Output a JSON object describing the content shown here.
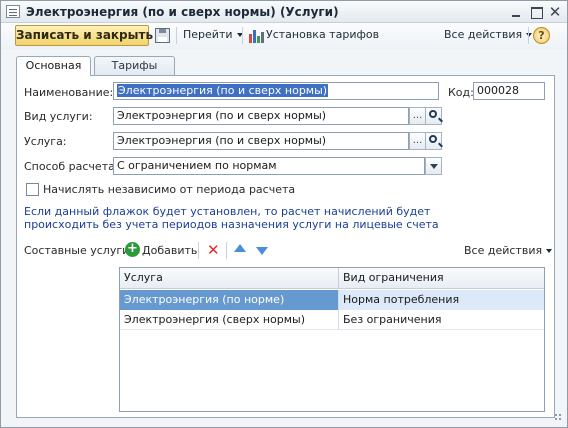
{
  "window": {
    "title": "Электроэнергия (по и сверх нормы) (Услуги)"
  },
  "toolbar": {
    "save_close_label": "Записать и закрыть",
    "goto_label": "Перейти",
    "tariffs_label": "Установка тарифов",
    "all_actions_label": "Все действия",
    "help_label": "?"
  },
  "tabs": [
    {
      "label": "Основная"
    },
    {
      "label": "Тарифы"
    }
  ],
  "form": {
    "name_label": "Наименование:",
    "name_value": "Электроэнергия (по и сверх нормы)",
    "code_label": "Код:",
    "code_value": "000028",
    "service_type_label": "Вид услуги:",
    "service_type_value": "Электроэнергия (по и сверх нормы)",
    "service_label": "Услуга:",
    "service_value": "Электроэнергия (по и сверх нормы)",
    "calc_method_label": "Способ расчета:",
    "calc_method_value": "С ограничением по нормам",
    "checkbox_label": "Начислять независимо от периода расчета",
    "info_text": "Если данный флажок будет установлен, то расчет начислений будет происходить без учета периодов назначения услуги на лицевые счета",
    "choose_label": "..."
  },
  "components": {
    "label": "Составные услуги:",
    "add_label": "Добавить",
    "all_actions_label": "Все действия",
    "columns": [
      "Услуга",
      "Вид ограничения"
    ],
    "rows": [
      {
        "service": "Электроэнергия (по норме)",
        "limit": "Норма потребления"
      },
      {
        "service": "Электроэнергия (сверх нормы)",
        "limit": "Без ограничения"
      }
    ]
  },
  "icons": {
    "app": "document-icon",
    "save": "save-icon",
    "tariffs": "bar-chart-icon",
    "help": "help-icon",
    "add": "add-icon",
    "delete": "delete-icon",
    "move_up": "arrow-up-icon",
    "move_down": "arrow-down-icon"
  },
  "colors": {
    "accent_button": "#f2d36a",
    "selection": "#3f70c3",
    "info_text": "#1b3e94"
  }
}
